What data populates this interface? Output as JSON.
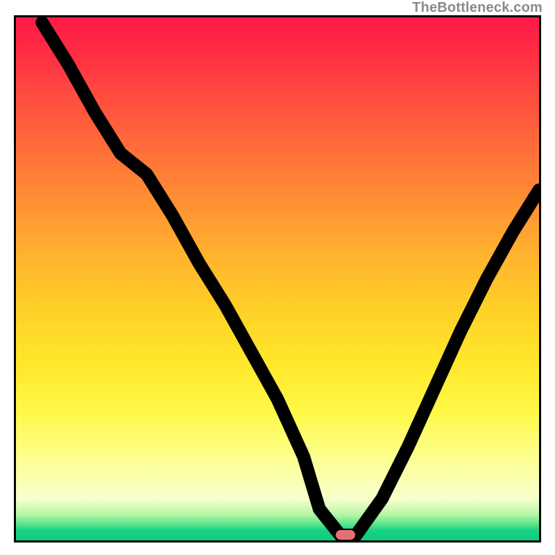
{
  "watermark": "TheBottleneck.com",
  "chart_data": {
    "type": "line",
    "title": "",
    "xlabel": "",
    "ylabel": "",
    "xlim": [
      0,
      100
    ],
    "ylim": [
      0,
      100
    ],
    "x": [
      5,
      10,
      15,
      20,
      25,
      30,
      35,
      40,
      45,
      50,
      55,
      58,
      62,
      65,
      70,
      75,
      80,
      85,
      90,
      95,
      100
    ],
    "y": [
      99,
      91,
      82,
      74,
      70,
      62,
      53,
      45,
      36,
      27,
      16,
      6,
      1,
      1,
      8,
      18,
      29,
      40,
      50,
      59,
      67
    ],
    "marker": {
      "x": 63,
      "y": 1
    },
    "background": {
      "type": "vertical-gradient",
      "stops": [
        {
          "pos": 0,
          "color": "#ff1a47"
        },
        {
          "pos": 24,
          "color": "#ff6a3a"
        },
        {
          "pos": 56,
          "color": "#ffd128"
        },
        {
          "pos": 84,
          "color": "#fdff8e"
        },
        {
          "pos": 97,
          "color": "#56e38b"
        },
        {
          "pos": 100,
          "color": "#11c97c"
        }
      ]
    }
  }
}
